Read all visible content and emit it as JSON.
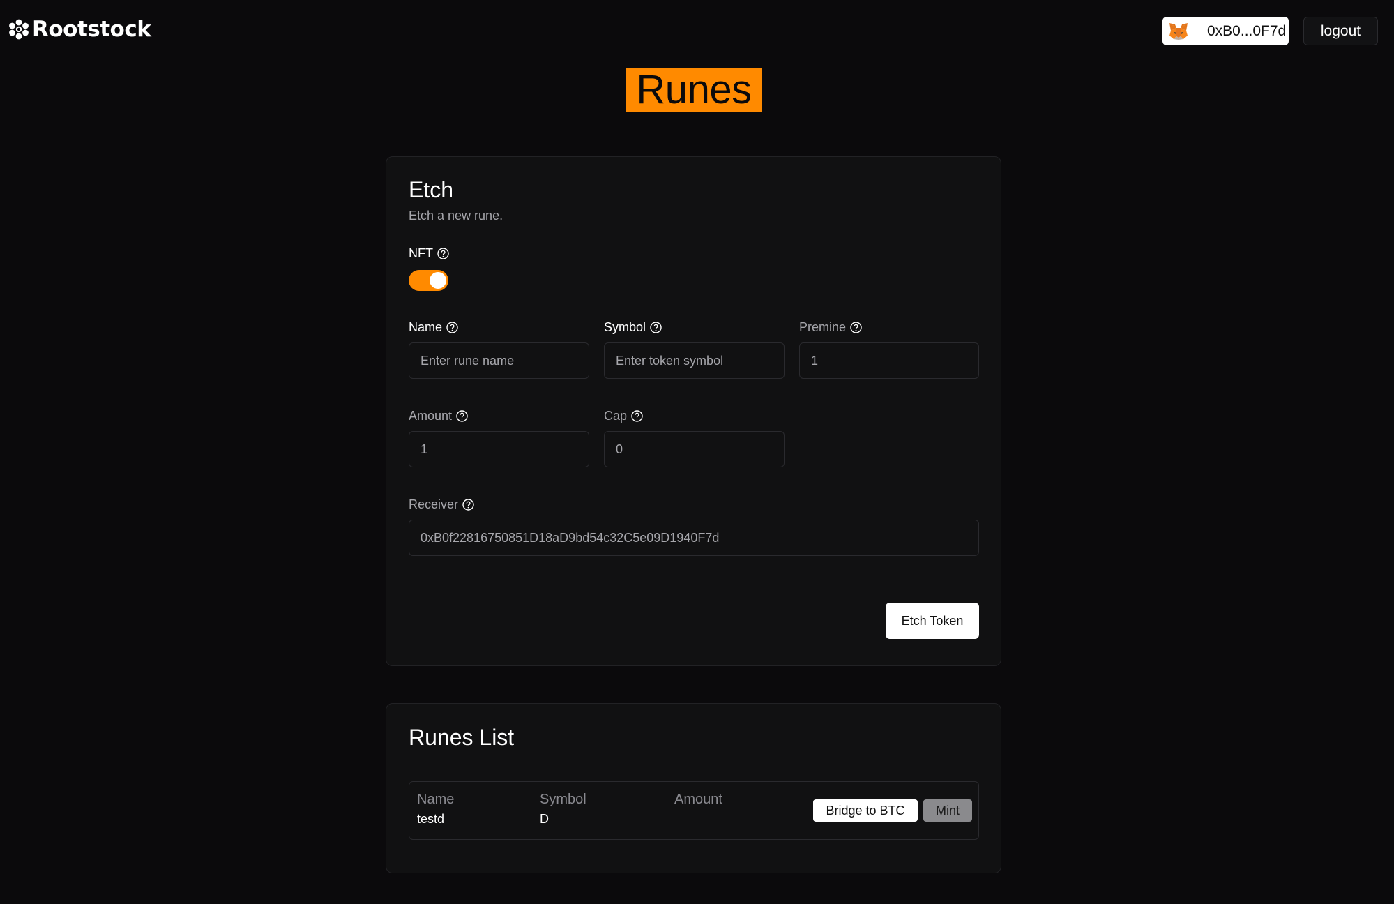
{
  "header": {
    "logo_text": "Rootstock",
    "wallet_address": "0xB0...0F7d",
    "logout_label": "logout"
  },
  "page_title": "Runes",
  "colors": {
    "accent": "#ff8a00",
    "background": "#0b0a0c",
    "card": "#111112"
  },
  "etch": {
    "title": "Etch",
    "subtitle": "Etch a new rune.",
    "nft_label": "NFT",
    "nft_enabled": true,
    "fields": {
      "name": {
        "label": "Name",
        "placeholder": "Enter rune name",
        "value": ""
      },
      "symbol": {
        "label": "Symbol",
        "placeholder": "Enter token symbol",
        "value": ""
      },
      "premine": {
        "label": "Premine",
        "value": "1"
      },
      "amount": {
        "label": "Amount",
        "value": "1"
      },
      "cap": {
        "label": "Cap",
        "value": "0"
      },
      "receiver": {
        "label": "Receiver",
        "value": "0xB0f22816750851D18aD9bd54c32C5e09D1940F7d"
      }
    },
    "submit_label": "Etch Token"
  },
  "runes_list": {
    "title": "Runes List",
    "columns": [
      "Name",
      "Symbol",
      "Amount"
    ],
    "rows": [
      {
        "name": "testd",
        "symbol": "D",
        "amount": ""
      }
    ],
    "bridge_label": "Bridge to BTC",
    "mint_label": "Mint"
  }
}
